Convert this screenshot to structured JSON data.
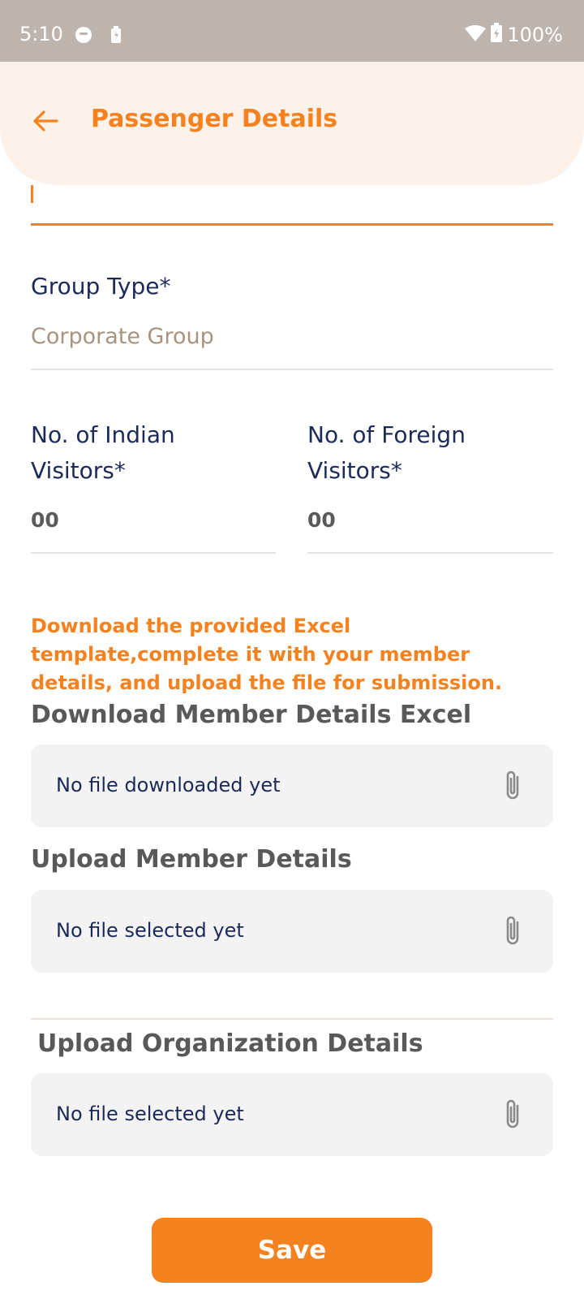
{
  "status_bar": {
    "time": "5:10",
    "battery": "100%"
  },
  "header": {
    "title": "Passenger Details"
  },
  "group_type": {
    "label": "Group Type*",
    "value": "Corporate Group"
  },
  "indian_visitors": {
    "label_line1": "No. of Indian",
    "label_line2": "Visitors*",
    "value": "00"
  },
  "foreign_visitors": {
    "label_line1": "No. of Foreign",
    "label_line2": "Visitors*",
    "value": "00"
  },
  "info": {
    "text": "Download the provided Excel template,complete it with your member details, and upload the file for submission."
  },
  "download_excel": {
    "title": "Download Member Details Excel",
    "file_text": "No file downloaded yet"
  },
  "upload_members": {
    "title": "Upload Member Details",
    "file_text": "No file selected yet"
  },
  "upload_org": {
    "title": "Upload Organization Details",
    "file_text": "No file selected yet"
  },
  "save_button": {
    "label": "Save"
  },
  "colors": {
    "accent": "#f5821f",
    "label": "#1c2a5a",
    "header_bg": "#fdf2e9",
    "status_bar": "#bdb4ae"
  }
}
